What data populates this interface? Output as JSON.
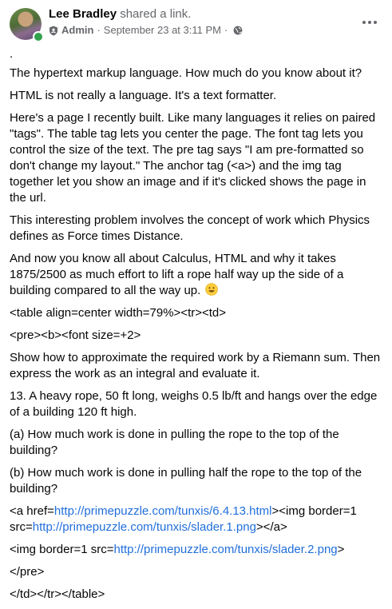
{
  "post": {
    "author": "Lee Bradley",
    "action": "shared a link.",
    "role": "Admin",
    "separator": "·",
    "timestamp": "September 23 at 3:11 PM",
    "audience_icon": "globe-icon",
    "role_icon": "admin-badge-icon",
    "more_icon": "more-options-icon"
  },
  "body": {
    "dot": ".",
    "p1": "The hypertext markup language. How much do you know about it?",
    "p2": "HTML is not really a language. It's a text formatter.",
    "p3": "Here's a page I recently built. Like many languages it relies on paired \"tags\". The table tag lets you center the page. The font tag lets you control the size of the text. The pre tag says \"I am pre-formatted so don't change my layout.\" The anchor tag (<a>) and the img tag together let you show an image and if it's clicked shows the page in the url.",
    "p4": "This interesting problem involves the concept of work which Physics defines as Force times Distance.",
    "p5": "And now you know all about Calculus, HTML and why it takes 1875/2500 as much effort to lift a rope half way up the side of a building compared to all the way up.",
    "p6": "<table align=center width=79%><tr><td>",
    "p7": "<pre><b><font size=+2>",
    "p8": "Show how to approximate the required work by a Riemann sum. Then express the work as an integral and evaluate it.",
    "p9": "13. A heavy rope, 50 ft long, weighs 0.5 lb/ft and hangs over the edge of a building 120 ft high.",
    "p10": "(a) How much work is done in pulling the rope to the top of the building?",
    "p11": "(b) How much work is done in pulling half the rope to the top of the building?",
    "p12_pre": "<a href=",
    "p12_link": "http://primepuzzle.com/tunxis/6.4.13.html",
    "p12_mid": "><img border=1 src=",
    "p12_link2": "http://primepuzzle.com/tunxis/slader.1.png",
    "p12_post": "></a>",
    "p13_pre": "<img border=1 src=",
    "p13_link": "http://primepuzzle.com/tunxis/slader.2.png",
    "p13_post": ">",
    "p14": "</pre>",
    "p15": "</td></tr></table>"
  },
  "colors": {
    "link": "#216fdb",
    "online": "#31a24c",
    "secondary_text": "#65676b"
  }
}
